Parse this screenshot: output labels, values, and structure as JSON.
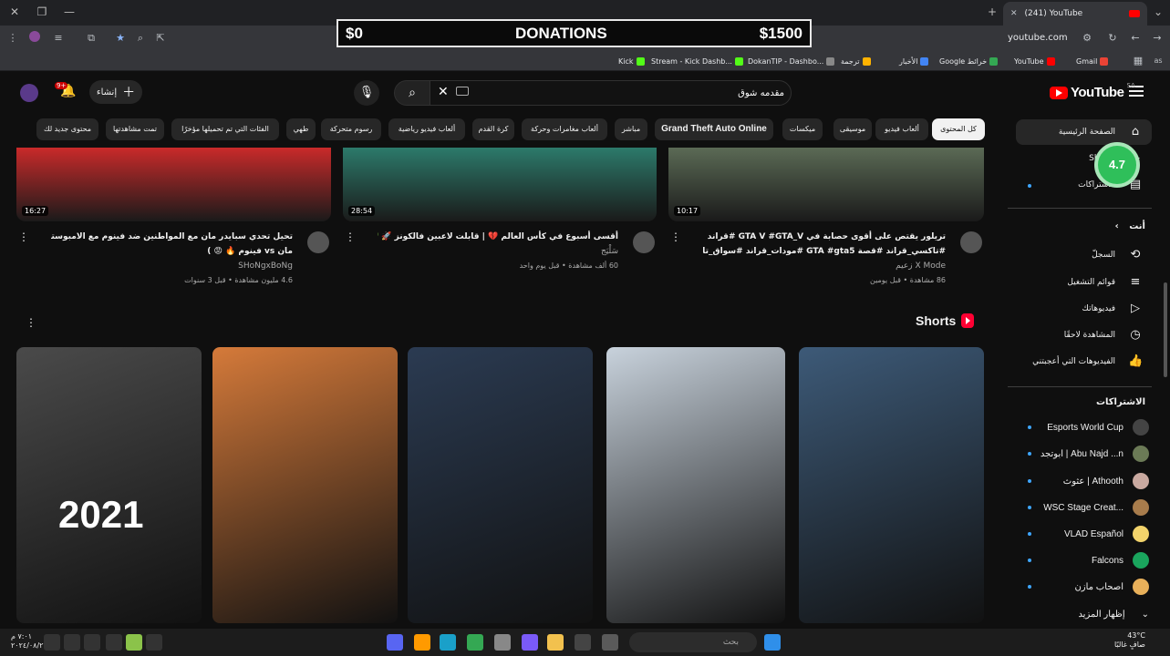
{
  "browser": {
    "tab_title": "(241) YouTube",
    "url": "youtube.com",
    "bookmarks": [
      {
        "label": "Kick",
        "color": "#53fc18"
      },
      {
        "label": "Stream - Kick Dashb...",
        "color": "#53fc18"
      },
      {
        "label": "DokanTIP - Dashbo...",
        "color": "#888888"
      },
      {
        "label": "ترجمة",
        "color": "#ffb300"
      },
      {
        "label": "الأخبار",
        "color": "#4285f4"
      },
      {
        "label": "Google خرائط",
        "color": "#34a853"
      },
      {
        "label": "YouTube",
        "color": "#ff0000"
      },
      {
        "label": "Gmail",
        "color": "#ea4335"
      }
    ]
  },
  "overlay": {
    "donation_current": "$0",
    "donation_label": "DONATIONS",
    "donation_goal": "$1500"
  },
  "header": {
    "logo_text": "YouTube",
    "region": "SA",
    "search_value": "مقدمه شوق",
    "create_label": "إنشاء",
    "notif_count": "9+"
  },
  "chips": [
    {
      "label": "كل المحتوى",
      "active": true
    },
    {
      "label": "ألعاب فيديو"
    },
    {
      "label": "موسيقى"
    },
    {
      "label": "ميكسات"
    },
    {
      "label": "Grand Theft Auto Online"
    },
    {
      "label": "مباشر"
    },
    {
      "label": "ألعاب مغامرات وحركة"
    },
    {
      "label": "كرة القدم"
    },
    {
      "label": "ألعاب فيديو رياضية"
    },
    {
      "label": "رسوم متحركة"
    },
    {
      "label": "طهي"
    },
    {
      "label": "الفئات التي تم تحميلها مؤخرًا"
    },
    {
      "label": "تمت مشاهدتها"
    },
    {
      "label": "محتوى جديد لك"
    }
  ],
  "sidebar": {
    "main": [
      {
        "label": "الصفحة الرئيسية",
        "icon": "home-icon"
      },
      {
        "label": "Shorts",
        "icon": "shorts-icon"
      },
      {
        "label": "الاشتراكات",
        "icon": "subscriptions-icon"
      }
    ],
    "you_heading": "أنت",
    "you_items": [
      {
        "label": "السجلّ",
        "icon": "history-icon"
      },
      {
        "label": "قوائم التشغيل",
        "icon": "playlist-icon"
      },
      {
        "label": "فيديوهاتك",
        "icon": "your-videos-icon"
      },
      {
        "label": "المشاهدة لاحقًا",
        "icon": "watch-later-icon"
      },
      {
        "label": "الفيديوهات التي أعجبتني",
        "icon": "like-icon"
      }
    ],
    "subs_heading": "الاشتراكات",
    "subscriptions": [
      {
        "label": "Esports World Cup",
        "color": "#444444"
      },
      {
        "label": "ابوتجد | Abu Najd ...n",
        "color": "#6b7a56"
      },
      {
        "label": "عثوث | Athooth",
        "color": "#c9a9a0"
      },
      {
        "label": "WSC Stage Creat...",
        "color": "#a87c4c"
      },
      {
        "label": "VLAD Español",
        "color": "#f2d36b"
      },
      {
        "label": "Falcons",
        "color": "#1aa55d"
      },
      {
        "label": "اصحاب مازن",
        "color": "#e8b05a"
      }
    ],
    "show_more": "إظهار المزيد",
    "rating": "4.7"
  },
  "videos": [
    {
      "title_line1": "تريلور يقتص على أقوى حصابة في GTA V #GTA_V #قراند",
      "title_line2": "#تاكسي_قراند #قصة GTA #gta5 #مودات_قراند #سواق_تاكسي",
      "channel": "X Mode زعيم",
      "meta": "86 مشاهدة • قبل يومين",
      "duration": "10:17",
      "thumb_color": "#5b6a55"
    },
    {
      "title_line1": "أقسى أسبوع في كأس العالم 💔 | قابلت لاعبين فالكونز 🚀 💚",
      "title_line2": "",
      "channel": "سَلْيَج",
      "meta": "60 ألف مشاهدة • قبل يوم واحد",
      "duration": "28:54",
      "thumb_color": "#2c7a6b"
    },
    {
      "title_line1": "تحيل تحدي سبايدر مان مع المواطنين ضد فينوم مع الامبوستر 🤯 !! ( سبايدر",
      "title_line2": "مان vs فينوم 🔥 😡 )",
      "channel": "SHoNgxBoNg",
      "meta": "4.6 مليون مشاهدة • قبل 3 سنوات",
      "duration": "16:27",
      "thumb_color": "#c92a2a"
    }
  ],
  "shorts": {
    "title": "Shorts",
    "items": [
      {
        "color": "#3d5a78",
        "overlay_text": ""
      },
      {
        "color": "#c8d2dc",
        "overlay_text": ""
      },
      {
        "color": "#2b3b52",
        "overlay_text": ""
      },
      {
        "color": "#d57a3a",
        "overlay_text": ""
      },
      {
        "color": "#4a4a4a",
        "overlay_text": "2021"
      }
    ]
  },
  "taskbar": {
    "search_placeholder": "بحث",
    "weather_temp": "43°C",
    "weather_desc": "صافٍ غالبًا",
    "clock_time": "٧:٠١ م",
    "clock_date": "٢٠٢٤/٠٨/٢٧"
  }
}
